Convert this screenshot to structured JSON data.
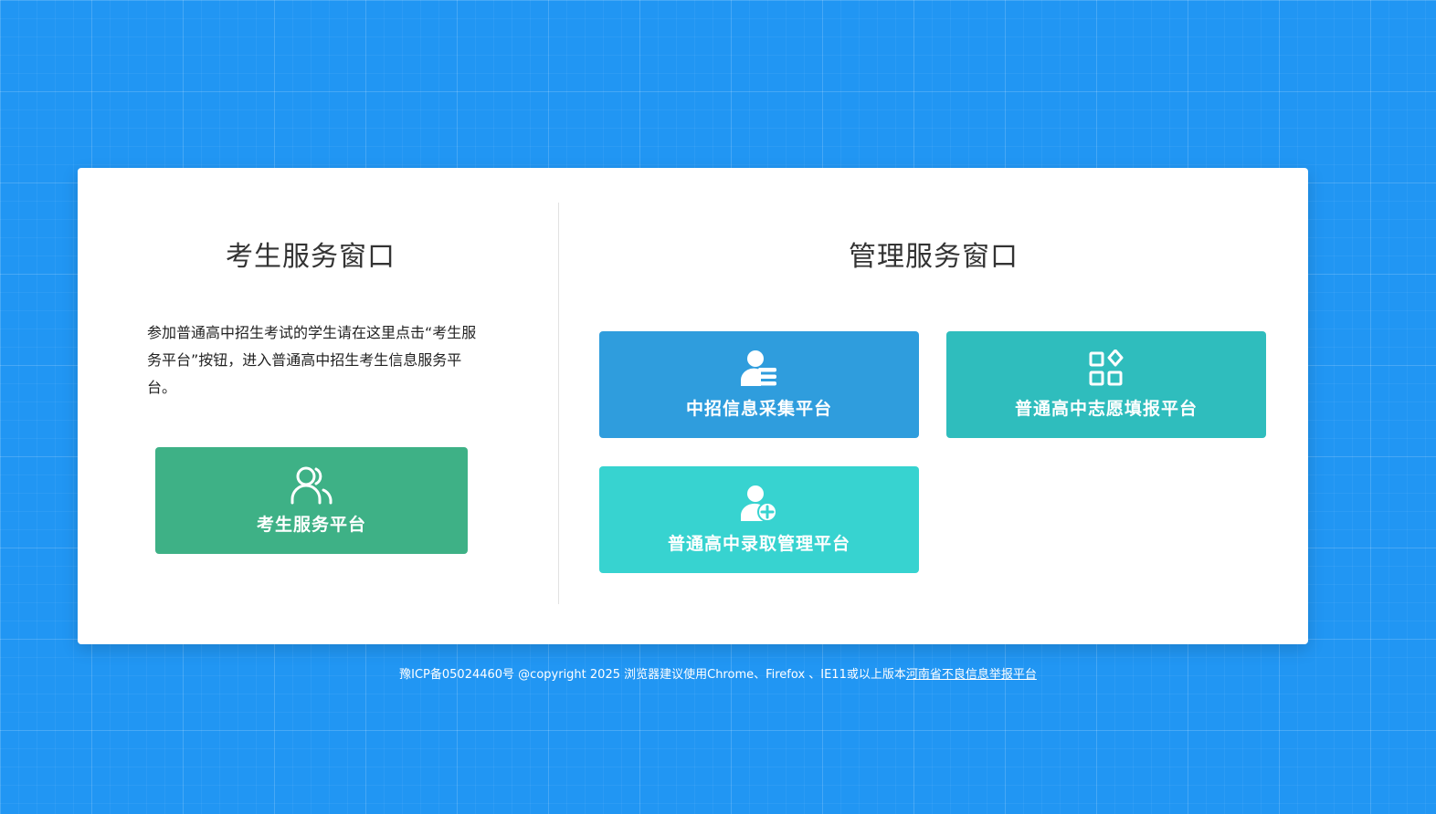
{
  "student_section": {
    "title": "考生服务窗口",
    "description": "参加普通高中招生考试的学生请在这里点击“考生服务平台”按钮，进入普通高中招生考生信息服务平台。",
    "button": {
      "label": "考生服务平台",
      "icon": "users-icon",
      "color": "#3eb186"
    }
  },
  "admin_section": {
    "title": "管理服务窗口",
    "buttons": [
      {
        "label": "中招信息采集平台",
        "icon": "user-list-icon",
        "color": "#2f9ddd"
      },
      {
        "label": "普通高中志愿填报平台",
        "icon": "apps-icon",
        "color": "#2fbdbd"
      },
      {
        "label": "普通高中录取管理平台",
        "icon": "user-add-icon",
        "color": "#37d3d0"
      }
    ]
  },
  "footer": {
    "text": "豫ICP备05024460号 @copyright 2025 浏览器建议使用Chrome、Firefox 、IE11或以上版本",
    "link": "河南省不良信息举报平台"
  }
}
